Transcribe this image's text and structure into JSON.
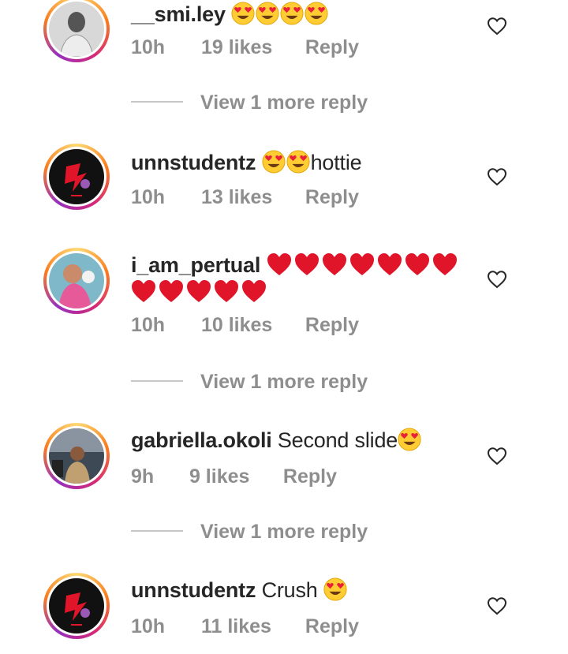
{
  "comments": [
    {
      "username": "__smi.ley",
      "text": "",
      "emojis": [
        "heart-eyes-emoji",
        "heart-eyes-emoji",
        "heart-eyes-emoji",
        "heart-eyes-emoji"
      ],
      "time": "10h",
      "likes": "19 likes",
      "reply": "Reply"
    },
    {
      "username": "unnstudentz",
      "text": "hottie",
      "emojis": [
        "heart-eyes-emoji",
        "heart-eyes-emoji"
      ],
      "time": "10h",
      "likes": "13 likes",
      "reply": "Reply"
    },
    {
      "username": "i_am_pertual",
      "text": "",
      "emojis": [
        "red-heart-emoji"
      ],
      "time": "10h",
      "likes": "10 likes",
      "reply": "Reply"
    },
    {
      "username": "gabriella.okoli",
      "text": "Second slide",
      "emojis": [
        "heart-eyes-emoji"
      ],
      "time": "9h",
      "likes": "9 likes",
      "reply": "Reply"
    },
    {
      "username": "unnstudentz",
      "text": "Crush",
      "emojis": [
        "heart-eyes-emoji"
      ],
      "time": "10h",
      "likes": "11 likes",
      "reply": "Reply"
    }
  ],
  "view_more": [
    "View 1 more reply",
    "View 1 more reply",
    "View 1 more reply"
  ],
  "colors": {
    "text": "#262626",
    "meta": "#8e8e8e",
    "heart": "#e0152a",
    "emoji_face": "#ffcc33"
  }
}
